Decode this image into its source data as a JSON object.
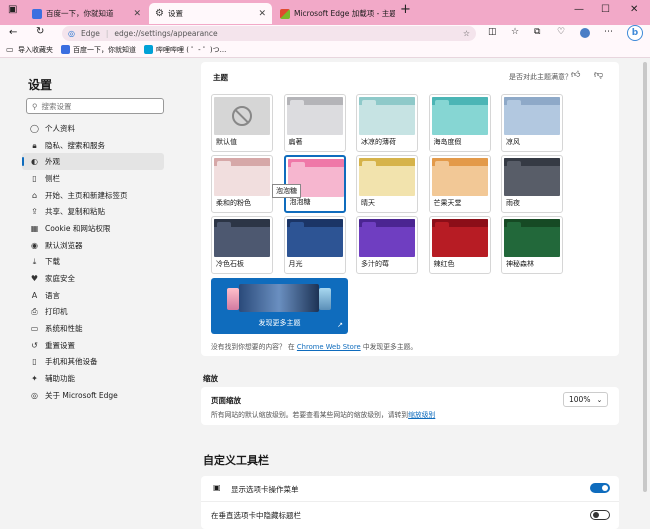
{
  "tabs": [
    {
      "title": "百度一下，你就知道",
      "color": "#3b6fe0"
    },
    {
      "title": "设置",
      "color": "#666666"
    },
    {
      "title": "Microsoft Edge 加载项 - 主题",
      "color": "#e04a2f"
    }
  ],
  "address": {
    "brand": "Edge",
    "url": "edge://settings/appearance"
  },
  "bookmarks": [
    "导入收藏夹",
    "百度一下，你就知道",
    "哔哩哔哩 ( ゜- ゜)つ..."
  ],
  "sidebar": {
    "title": "设置",
    "search_placeholder": "搜索设置",
    "items": [
      {
        "label": "个人资料",
        "icon": "person-icon"
      },
      {
        "label": "隐私、搜索和服务",
        "icon": "lock-icon"
      },
      {
        "label": "外观",
        "icon": "palette-icon"
      },
      {
        "label": "侧栏",
        "icon": "sidebar-icon"
      },
      {
        "label": "开始、主页和新建标签页",
        "icon": "home-icon"
      },
      {
        "label": "共享、复制和粘贴",
        "icon": "share-icon"
      },
      {
        "label": "Cookie 和网站权限",
        "icon": "cookie-icon"
      },
      {
        "label": "默认浏览器",
        "icon": "browser-icon"
      },
      {
        "label": "下载",
        "icon": "download-icon"
      },
      {
        "label": "家庭安全",
        "icon": "family-icon"
      },
      {
        "label": "语言",
        "icon": "language-icon"
      },
      {
        "label": "打印机",
        "icon": "printer-icon"
      },
      {
        "label": "系统和性能",
        "icon": "system-icon"
      },
      {
        "label": "重置设置",
        "icon": "reset-icon"
      },
      {
        "label": "手机和其他设备",
        "icon": "phone-icon"
      },
      {
        "label": "辅助功能",
        "icon": "accessibility-icon"
      },
      {
        "label": "关于 Microsoft Edge",
        "icon": "edge-icon"
      }
    ]
  },
  "themes": {
    "heading": "主题",
    "feedback": "是否对此主题满意？",
    "items": [
      {
        "label": "默认值",
        "bar": "#d0d0d0",
        "body": "#d6d6d6"
      },
      {
        "label": "扁著",
        "bar": "#b4b4b8",
        "body": "#dcdcdf"
      },
      {
        "label": "冰凉的薄荷",
        "bar": "#8ec9c9",
        "body": "#c6e3e3"
      },
      {
        "label": "海岛度假",
        "bar": "#4bb5b5",
        "body": "#86d6d3"
      },
      {
        "label": "凉风",
        "bar": "#8ea9c8",
        "body": "#b2c8e0"
      },
      {
        "label": "柔和的粉色",
        "bar": "#d6a8a8",
        "body": "#f1dede"
      },
      {
        "label": "泡泡糖",
        "bar": "#ef78a8",
        "body": "#f6b6cf"
      },
      {
        "label": "晴天",
        "bar": "#d6b34a",
        "body": "#f2e3ad"
      },
      {
        "label": "芒果天堂",
        "bar": "#e39a4a",
        "body": "#f2c896"
      },
      {
        "label": "雨夜",
        "bar": "#353a44",
        "body": "#585d68"
      },
      {
        "label": "冷色石板",
        "bar": "#2c3546",
        "body": "#4d5870"
      },
      {
        "label": "月光",
        "bar": "#1b3566",
        "body": "#2d5494"
      },
      {
        "label": "多汁的莓",
        "bar": "#4b2592",
        "body": "#6f3ec1"
      },
      {
        "label": "辣红色",
        "bar": "#8c0e18",
        "body": "#b71c24"
      },
      {
        "label": "神秘森林",
        "bar": "#164a24",
        "body": "#22683a"
      }
    ],
    "tooltip": "泡泡糖",
    "discover_label": "发现更多主题",
    "note_prefix": "没有找到你想要的内容？ 在",
    "note_link": "Chrome Web Store",
    "note_suffix": "中发现更多主题。"
  },
  "zoom": {
    "heading": "缩放",
    "title": "页面缩放",
    "desc": "所有网站的默认缩放级别。若要查看某些网站的缩放级别，请转到",
    "desc_link": "缩放级别",
    "value": "100%"
  },
  "toolbar": {
    "heading": "自定义工具栏",
    "rows": [
      {
        "label": "显示选项卡操作菜单",
        "on": true
      },
      {
        "label": "在垂直选项卡中隐藏标题栏",
        "on": false
      }
    ]
  }
}
